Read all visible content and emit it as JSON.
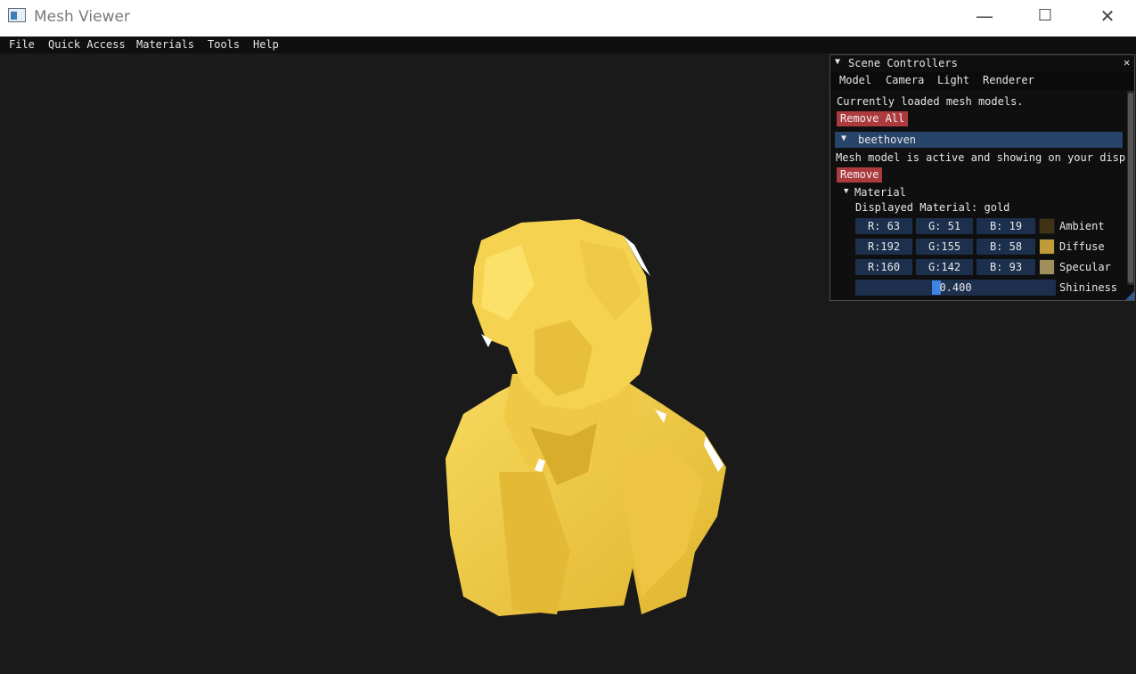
{
  "window": {
    "title": "Mesh Viewer",
    "controls": {
      "minimize": "—",
      "maximize": "☐",
      "close": "✕"
    }
  },
  "menubar": [
    "File",
    "Quick Access",
    "Materials",
    "Tools",
    "Help"
  ],
  "panel": {
    "title": "Scene Controllers",
    "close": "✕",
    "tabs": [
      "Model",
      "Camera",
      "Light",
      "Renderer"
    ],
    "intro": "Currently loaded mesh models.",
    "remove_all": "Remove All",
    "model": {
      "name": "beethoven",
      "status": "Mesh model is active and showing on your displ",
      "remove": "Remove",
      "material_label": "Material",
      "displayed_material": "Displayed Material: gold",
      "rows": [
        {
          "r": "R: 63",
          "g": "G: 51",
          "b": "B: 19",
          "label": "Ambient",
          "color": "#3f3313"
        },
        {
          "r": "R:192",
          "g": "G:155",
          "b": "B: 58",
          "label": "Diffuse",
          "color": "#c09b3a"
        },
        {
          "r": "R:160",
          "g": "G:142",
          "b": "B: 93",
          "label": "Specular",
          "color": "#a08e5d"
        }
      ],
      "shininess_value": "0.400",
      "shininess_label": "Shininess"
    }
  },
  "colors": {
    "viewport": "#1a1a1a",
    "mesh_gold": "#f2cd47",
    "accent_blue": "#3d85e0",
    "button_red": "#ad3b3e"
  },
  "icons": {
    "collapse": "triangle-down-icon"
  }
}
